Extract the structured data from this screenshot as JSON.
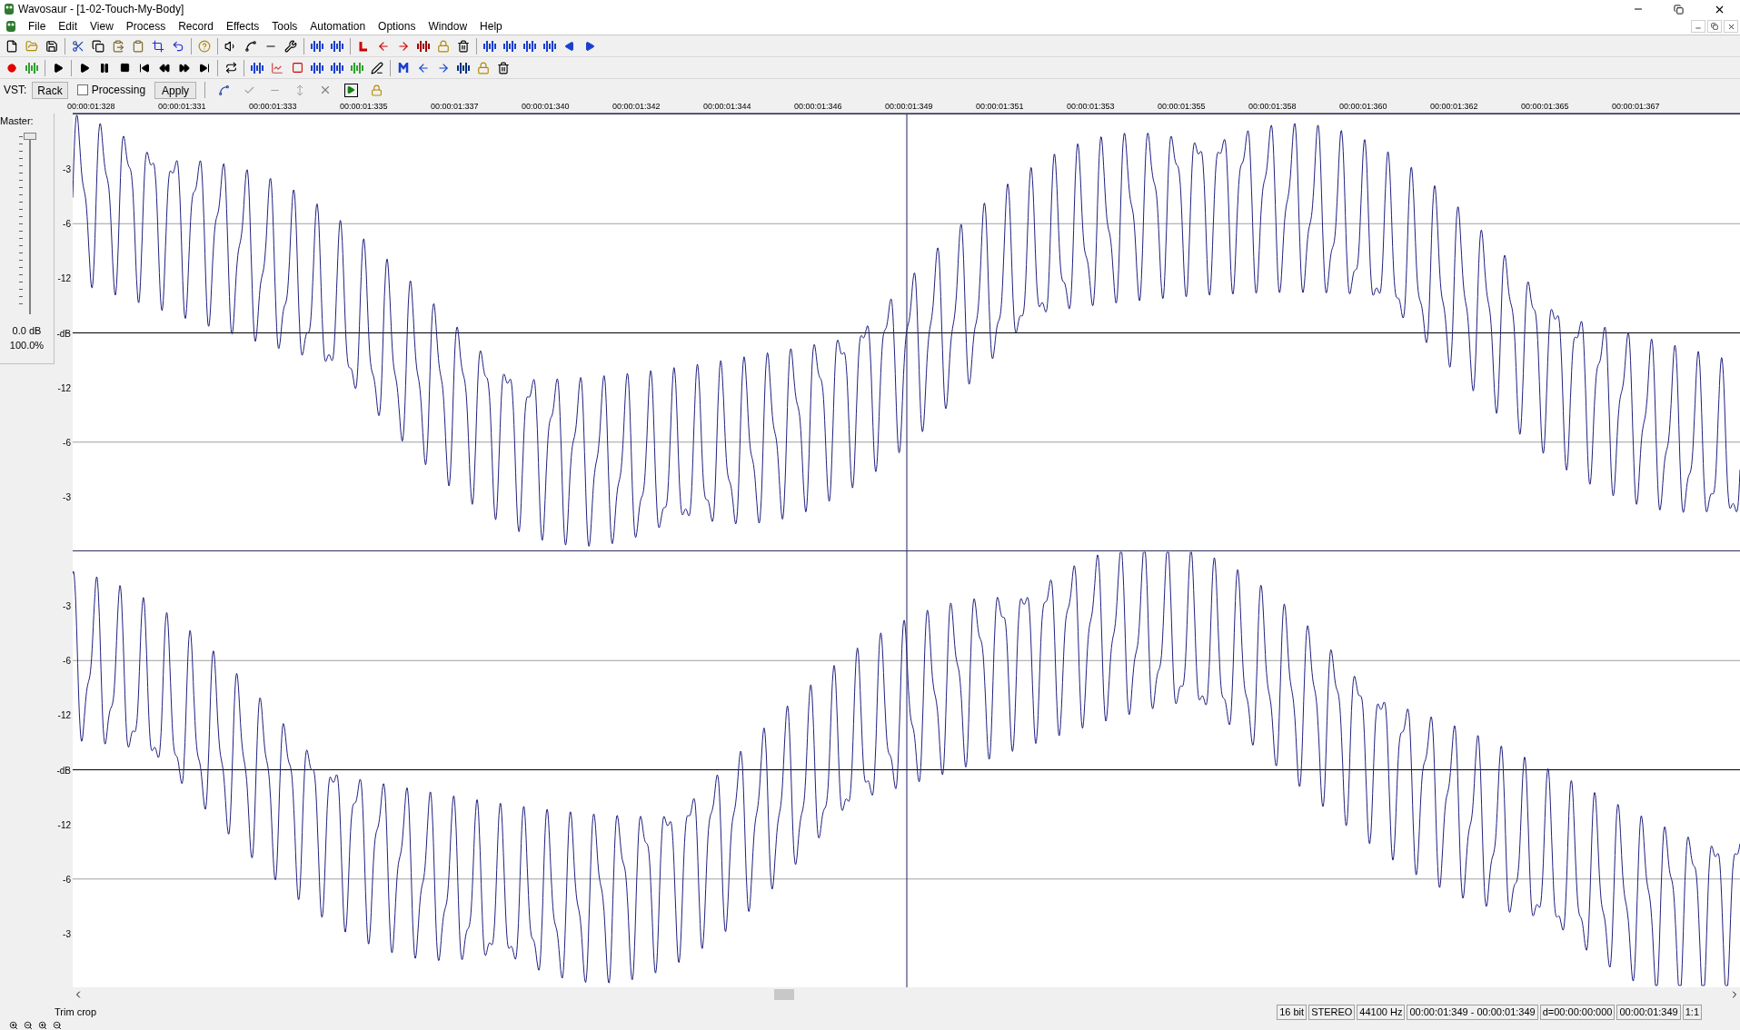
{
  "window": {
    "title": "Wavosaur - [1-02-Touch-My-Body]"
  },
  "menu": [
    "File",
    "Edit",
    "View",
    "Process",
    "Record",
    "Effects",
    "Tools",
    "Automation",
    "Options",
    "Window",
    "Help"
  ],
  "vst_bar": {
    "label": "VST:",
    "rack_button": "Rack",
    "processing": {
      "label": "Processing",
      "checked": false
    },
    "apply_button": "Apply"
  },
  "ruler": [
    "00:00:01:328",
    "00:00:01:331",
    "00:00:01:333",
    "00:00:01:335",
    "00:00:01:337",
    "00:00:01:340",
    "00:00:01:342",
    "00:00:01:344",
    "00:00:01:346",
    "00:00:01:349",
    "00:00:01:351",
    "00:00:01:353",
    "00:00:01:355",
    "00:00:01:358",
    "00:00:01:360",
    "00:00:01:362",
    "00:00:01:365",
    "00:00:01:367"
  ],
  "master": {
    "label": "Master:",
    "level": 1,
    "db": "0.0 dB",
    "percent": "100.0%"
  },
  "channels": [
    {
      "scale": [
        "-3",
        "-6",
        "-12",
        "-dB",
        "-12",
        "-6",
        "-3"
      ]
    },
    {
      "scale": [
        "-3",
        "-6",
        "-12",
        "-dB",
        "-12",
        "-6",
        "-3"
      ]
    }
  ],
  "status_bar": {
    "message": "Trim crop",
    "fields": [
      "16 bit",
      "STEREO",
      "44100 Hz",
      "00:00:01:349 - 00:00:01:349",
      "d=00:00:00:000",
      "00:00:01:349",
      "1:1"
    ]
  }
}
